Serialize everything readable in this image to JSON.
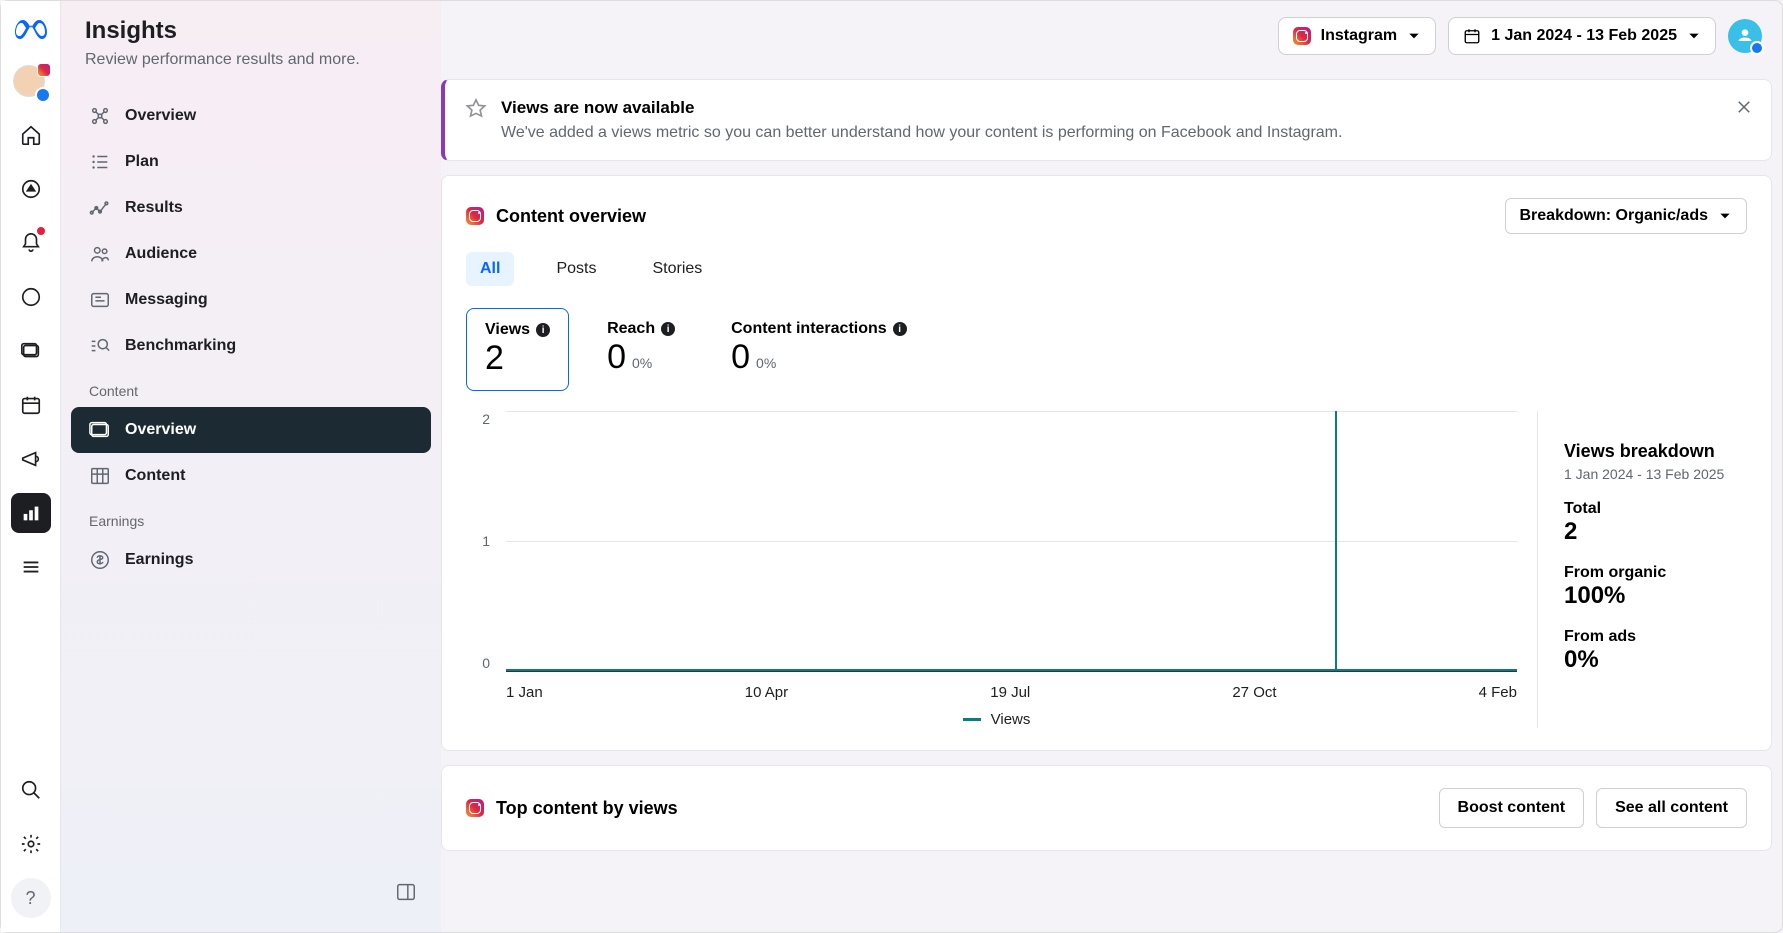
{
  "header": {
    "title": "Insights",
    "subtitle": "Review performance results and more."
  },
  "topbar": {
    "platform": "Instagram",
    "date_range": "1 Jan 2024 - 13 Feb 2025"
  },
  "sidebar": {
    "items": [
      {
        "label": "Overview",
        "icon": "overview"
      },
      {
        "label": "Plan",
        "icon": "plan"
      },
      {
        "label": "Results",
        "icon": "results"
      },
      {
        "label": "Audience",
        "icon": "audience"
      },
      {
        "label": "Messaging",
        "icon": "messaging"
      },
      {
        "label": "Benchmarking",
        "icon": "benchmark"
      }
    ],
    "section_content": "Content",
    "content_items": [
      {
        "label": "Overview",
        "active": true
      },
      {
        "label": "Content"
      }
    ],
    "section_earnings": "Earnings",
    "earnings_items": [
      {
        "label": "Earnings"
      }
    ]
  },
  "banner": {
    "title": "Views are now available",
    "text": "We've added a views metric so you can better understand how your content is performing on Facebook and Instagram."
  },
  "content_overview": {
    "title": "Content overview",
    "breakdown_label": "Breakdown: Organic/ads",
    "tabs": [
      "All",
      "Posts",
      "Stories"
    ],
    "active_tab": "All",
    "metrics": [
      {
        "label": "Views",
        "value": "2",
        "pct": "",
        "active": true
      },
      {
        "label": "Reach",
        "value": "0",
        "pct": "0%"
      },
      {
        "label": "Content interactions",
        "value": "0",
        "pct": "0%"
      }
    ],
    "legend": "Views",
    "breakdown_panel": {
      "title": "Views breakdown",
      "subtitle": "1 Jan 2024 - 13 Feb 2025",
      "rows": [
        {
          "label": "Total",
          "value": "2"
        },
        {
          "label": "From organic",
          "value": "100%"
        },
        {
          "label": "From ads",
          "value": "0%"
        }
      ]
    }
  },
  "top_content": {
    "title": "Top content by views",
    "boost": "Boost content",
    "see_all": "See all content"
  },
  "chart_data": {
    "type": "line",
    "ylabel": "",
    "xlabel": "",
    "ylim": [
      0,
      2
    ],
    "y_ticks": [
      "2",
      "1",
      "0"
    ],
    "categories": [
      "1 Jan",
      "10 Apr",
      "19 Jul",
      "27 Oct",
      "4 Feb"
    ],
    "series": [
      {
        "name": "Views",
        "color": "#0a7e7e",
        "baseline": 0,
        "spike_x_fraction": 0.82,
        "spike_value": 2
      }
    ]
  }
}
